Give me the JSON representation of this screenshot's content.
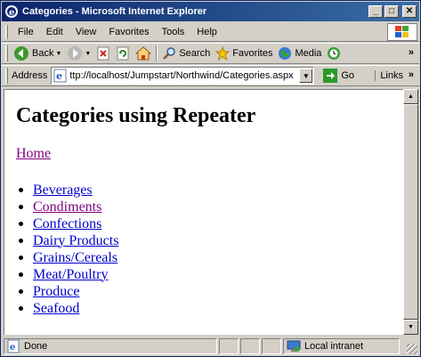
{
  "window": {
    "title": "Categories - Microsoft Internet Explorer",
    "buttons": {
      "minimize": "_",
      "maximize": "□",
      "close": "✕"
    }
  },
  "menu": {
    "items": [
      "File",
      "Edit",
      "View",
      "Favorites",
      "Tools",
      "Help"
    ]
  },
  "toolbar": {
    "back_label": "Back",
    "search_label": "Search",
    "favorites_label": "Favorites",
    "media_label": "Media"
  },
  "address": {
    "label": "Address",
    "url": "ttp://localhost/Jumpstart/Northwind/Categories.aspx",
    "go_label": "Go",
    "links_label": "Links"
  },
  "page": {
    "heading": "Categories using Repeater",
    "home_link": "Home",
    "categories": [
      {
        "name": "Beverages",
        "visited": false
      },
      {
        "name": "Condiments",
        "visited": true
      },
      {
        "name": "Confections",
        "visited": false
      },
      {
        "name": "Dairy Products",
        "visited": false
      },
      {
        "name": "Grains/Cereals",
        "visited": false
      },
      {
        "name": "Meat/Poultry",
        "visited": false
      },
      {
        "name": "Produce",
        "visited": false
      },
      {
        "name": "Seafood",
        "visited": false
      }
    ]
  },
  "status": {
    "text": "Done",
    "zone": "Local intranet"
  },
  "colors": {
    "link": "#0000cc",
    "visited_link": "#800080",
    "titlebar": "#0a246a"
  }
}
